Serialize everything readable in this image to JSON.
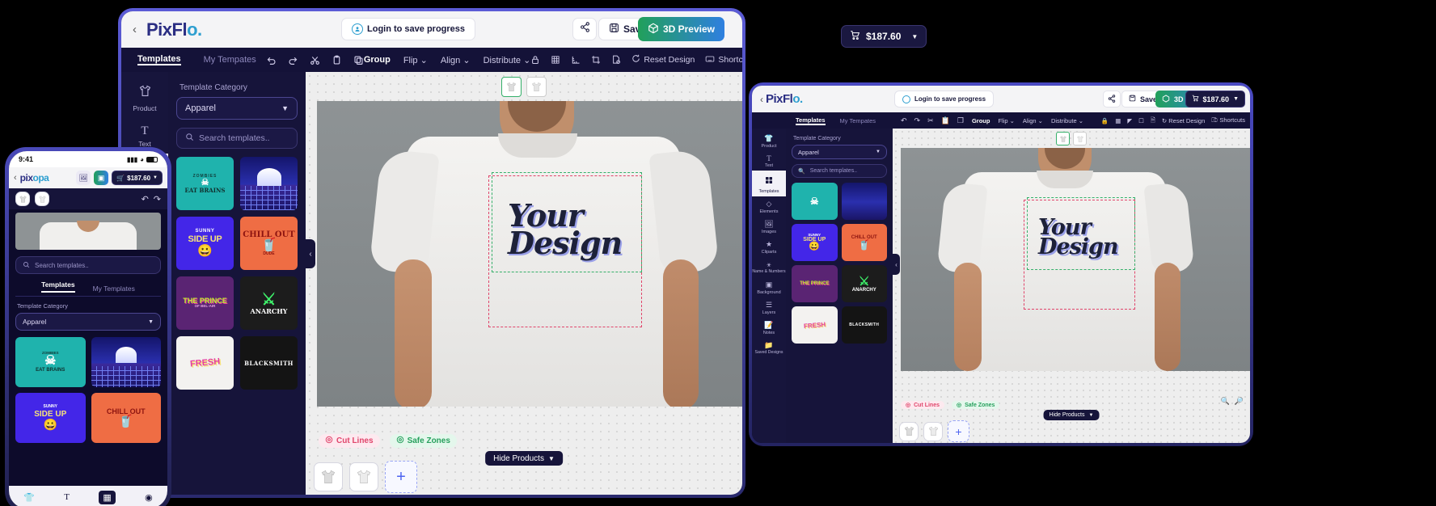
{
  "brand": {
    "name_pix": "PixFl",
    "name_o": "o",
    "dot": ".",
    "mobile_name": "pixopa"
  },
  "header": {
    "back_icon": "chevron-left-icon",
    "login_label": "Login to save progress",
    "login_icon": "user-circle-icon",
    "share_icon": "share-icon",
    "save_label": "Save",
    "save_icon": "save-disk-icon",
    "preview_label": "3D Preview",
    "preview_icon": "cube-icon",
    "cart_icon": "cart-icon",
    "price": "$187.60",
    "cart_chevron": "chevron-down-icon"
  },
  "toolbar": {
    "undo_icon": "undo-icon",
    "redo_icon": "redo-icon",
    "cut_icon": "scissors-icon",
    "copy_icon": "clipboard-icon",
    "paste_icon": "duplicate-icon",
    "group_label": "Group",
    "flip_label": "Flip",
    "align_label": "Align",
    "distribute_label": "Distribute",
    "lock_icon": "lock-icon",
    "grid_icon": "grid-icon",
    "ruler_icon": "ruler-icon",
    "crop_icon": "crop-icon",
    "page_icon": "page-remove-icon",
    "reset_label": "Reset Design",
    "reset_icon": "refresh-icon",
    "shortcuts_label": "Shortcuts",
    "shortcuts_icon": "keyboard-icon"
  },
  "left_rail": [
    {
      "label": "Product",
      "icon": "tshirt-icon",
      "active": false
    },
    {
      "label": "Text",
      "icon": "text-t-icon",
      "active": false
    },
    {
      "label": "Templates",
      "icon": "grid-squares-icon",
      "active": true
    },
    {
      "label": "Elements",
      "icon": "shapes-icon",
      "active": false
    },
    {
      "label": "Images",
      "icon": "image-icon",
      "active": false
    },
    {
      "label": "Cliparts",
      "icon": "star-icon",
      "active": false
    },
    {
      "label": "Name & Numbers",
      "icon": "jersey-number-icon",
      "active": false
    },
    {
      "label": "Background",
      "icon": "background-icon",
      "active": false
    },
    {
      "label": "Layers",
      "icon": "layers-icon",
      "active": false
    },
    {
      "label": "Notes",
      "icon": "note-icon",
      "active": false
    },
    {
      "label": "Saved Designs",
      "icon": "folder-icon",
      "active": false
    }
  ],
  "panel": {
    "tab_templates": "Templates",
    "tab_my_templates": "My Tempates",
    "category_label": "Template Category",
    "category_value": "Apparel",
    "category_chevron": "chevron-down-icon",
    "search_placeholder": "Search templates..",
    "search_icon": "search-icon"
  },
  "templates": [
    {
      "name": "zombies-eat-brains",
      "title": "EAT BRAINS",
      "kicker": "ZOMBIES",
      "bg": "#1fb3ad",
      "fg": "#11322f"
    },
    {
      "name": "retro-sunset",
      "title": "",
      "kicker": "",
      "bg": "#1d1f6e",
      "fg": "#ffffff"
    },
    {
      "name": "sunny-side-up",
      "title": "SIDE UP",
      "kicker": "SUNNY",
      "bg": "#4326e8",
      "fg": "#f6e27a"
    },
    {
      "name": "chill-out-dude",
      "title": "CHILL OUT",
      "kicker": "DUDE",
      "bg": "#ef6d44",
      "fg": "#7c1410"
    },
    {
      "name": "the-prince",
      "title": "THE PRINCE",
      "kicker": "OF BEL-AIR",
      "bg": "#5a2473",
      "fg": "#b9f22a"
    },
    {
      "name": "anarchy",
      "title": "ANARCHY",
      "kicker": "",
      "bg": "#1c1c1c",
      "fg": "#3ef06a"
    },
    {
      "name": "fresh-graffiti",
      "title": "FRESH",
      "kicker": "",
      "bg": "#f3f2f0",
      "fg": "#e53fa0"
    },
    {
      "name": "blacksmith",
      "title": "BLACKSMITH",
      "kicker": "",
      "bg": "#141414",
      "fg": "#ffffff"
    }
  ],
  "canvas": {
    "design_line1": "Your",
    "design_line2": "Design",
    "view_front": "front-view-thumb",
    "view_back": "back-view-thumb"
  },
  "footer": {
    "cut_lines_label": "Cut Lines",
    "cut_lines_icon": "target-icon",
    "safe_zones_label": "Safe Zones",
    "safe_zones_icon": "target-icon",
    "hide_products_label": "Hide Products",
    "hide_products_chevron": "chevron-down-icon",
    "add_icon": "plus-icon",
    "zoom_in_icon": "zoom-in-icon",
    "zoom_out_icon": "zoom-out-icon"
  },
  "mobile": {
    "time": "9:41",
    "signal_icon": "signal-icon",
    "wifi_icon": "wifi-icon",
    "battery_icon": "battery-icon",
    "back_icon": "chevron-left-icon",
    "image_icon": "image-icon",
    "cube_icon": "cube-icon",
    "cart_icon": "cart-icon",
    "price": "$187.60",
    "chevron": "chevron-down-icon",
    "undo_icon": "undo-icon",
    "redo_icon": "redo-icon",
    "search_placeholder": "Search templates..",
    "tab_templates": "Templates",
    "tab_my_templates": "My Templates",
    "category_label": "Template Category",
    "category_value": "Apparel"
  },
  "colors": {
    "accent_green": "#21a05a",
    "accent_blue": "#2f7fe0",
    "panel_bg": "#16143a",
    "rail_bg": "#17153c",
    "cut": "#e0456b",
    "safe": "#27a05d"
  }
}
